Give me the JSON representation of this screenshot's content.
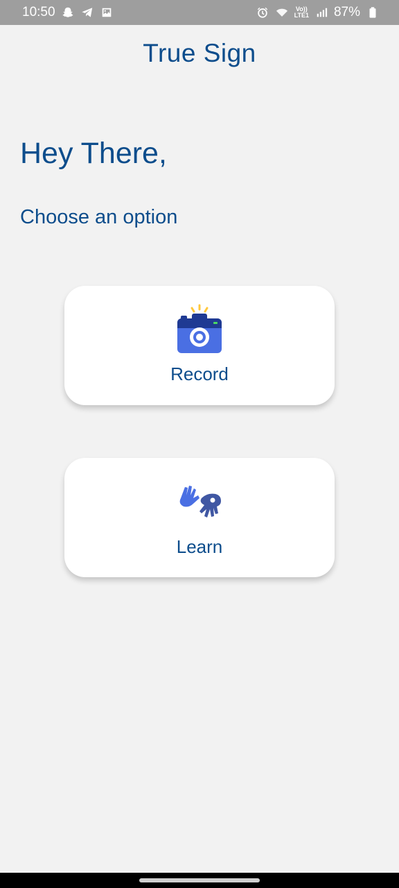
{
  "status_bar": {
    "time": "10:50",
    "battery": "87%",
    "network_label_top": "Vo))",
    "network_label_bottom": "LTE1",
    "left_icons": [
      "snapchat-icon",
      "telegram-icon",
      "gallery-icon"
    ],
    "right_icons": [
      "alarm-icon",
      "wifi-icon",
      "signal-icon",
      "battery-icon"
    ]
  },
  "header": {
    "title": "True Sign"
  },
  "main": {
    "greeting": "Hey There,",
    "subtitle": "Choose an option",
    "options": [
      {
        "label": "Record",
        "icon": "camera-icon"
      },
      {
        "label": "Learn",
        "icon": "sign-language-icon"
      }
    ]
  },
  "colors": {
    "text_primary": "#0d4d8c",
    "accent_blue": "#4a6fe3",
    "icon_dark": "#1f3a93",
    "flash_yellow": "#ffc83d",
    "background": "#f2f2f2",
    "card": "#ffffff"
  }
}
